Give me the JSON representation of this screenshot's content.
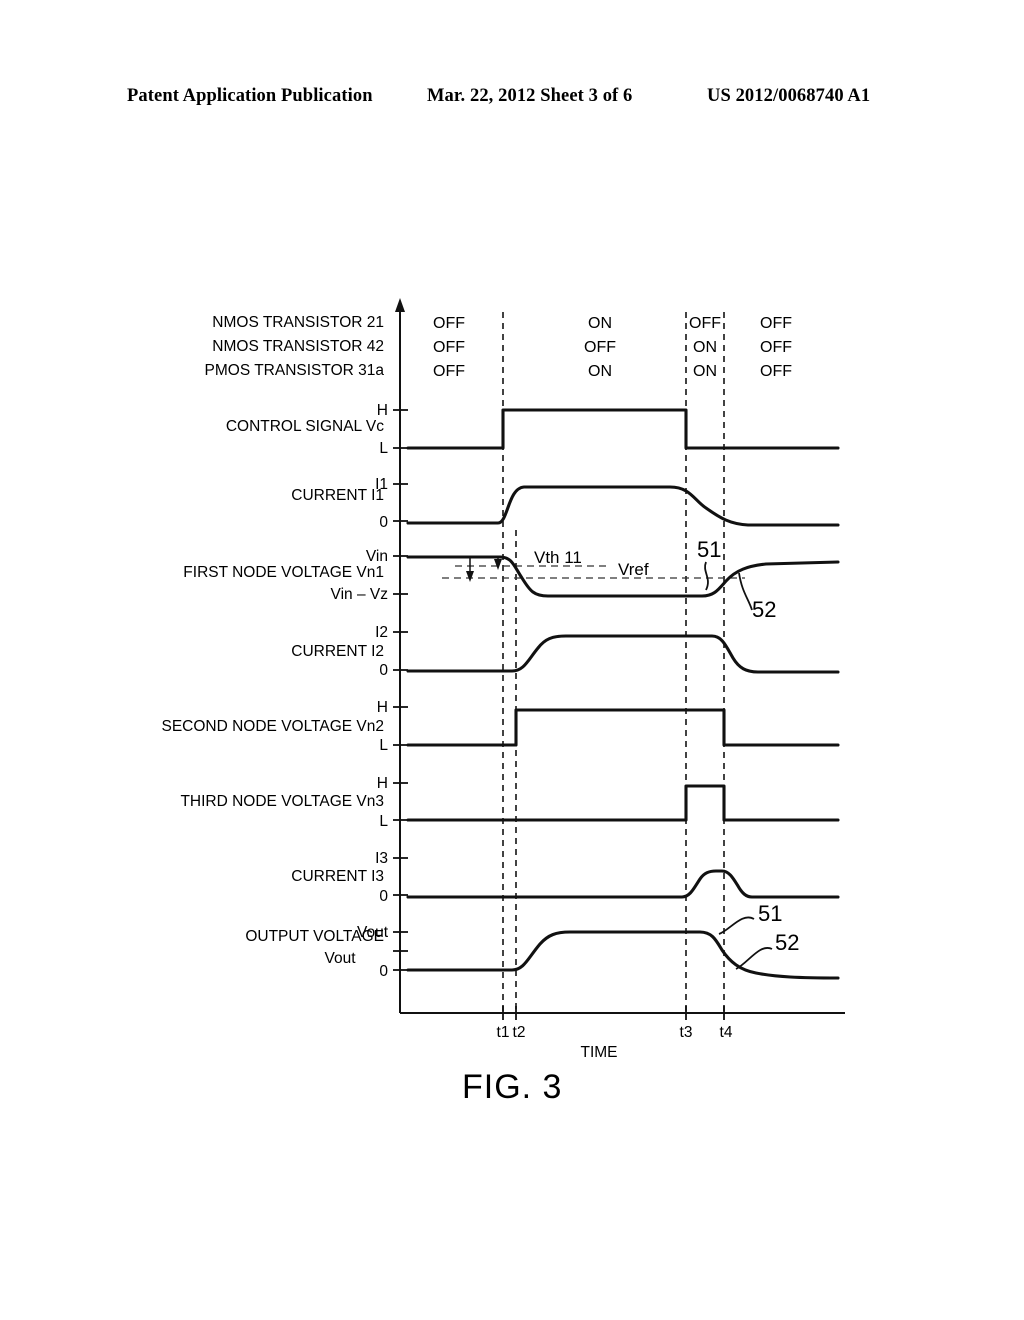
{
  "header": {
    "left": "Patent Application Publication",
    "middle": "Mar. 22, 2012  Sheet 3 of 6",
    "right": "US 2012/0068740 A1"
  },
  "figure": {
    "caption": "FIG. 3",
    "x_axis_label": "TIME",
    "time_marks": [
      "t1",
      "t2",
      "t3",
      "t4"
    ]
  },
  "state_table": {
    "rows": [
      {
        "label": "NMOS TRANSISTOR 21",
        "states": [
          "OFF",
          "ON",
          "OFF",
          "OFF"
        ]
      },
      {
        "label": "NMOS TRANSISTOR 42",
        "states": [
          "OFF",
          "OFF",
          "ON",
          "OFF"
        ]
      },
      {
        "label": "PMOS TRANSISTOR 31a",
        "states": [
          "OFF",
          "ON",
          "ON",
          "OFF"
        ]
      }
    ]
  },
  "waveforms": [
    {
      "name": "control-signal-vc",
      "label": "CONTROL SIGNAL Vc",
      "label2": "",
      "ticks": [
        "H",
        "L"
      ]
    },
    {
      "name": "current-i1",
      "label": "CURRENT I1",
      "label2": "",
      "ticks": [
        "I1",
        "0"
      ]
    },
    {
      "name": "first-node-voltage-vn1",
      "label": "FIRST NODE VOLTAGE Vn1",
      "label2": "",
      "ticks": [
        "Vin",
        "Vin – Vz"
      ]
    },
    {
      "name": "current-i2",
      "label": "CURRENT I2",
      "label2": "",
      "ticks": [
        "I2",
        "0"
      ]
    },
    {
      "name": "second-node-voltage-vn2",
      "label": "SECOND NODE VOLTAGE Vn2",
      "label2": "",
      "ticks": [
        "H",
        "L"
      ]
    },
    {
      "name": "third-node-voltage-vn3",
      "label": "THIRD NODE VOLTAGE Vn3",
      "label2": "",
      "ticks": [
        "H",
        "L"
      ]
    },
    {
      "name": "current-i3",
      "label": "CURRENT I3",
      "label2": "",
      "ticks": [
        "I3",
        "0"
      ]
    },
    {
      "name": "output-voltage-vout",
      "label": "OUTPUT VOLTAGE",
      "label2": "Vout",
      "ticks": [
        "Vout",
        "0"
      ]
    }
  ],
  "annotations": {
    "vth": "Vth 11",
    "vref": "Vref",
    "callout_vn1_51": "51",
    "callout_vn1_52": "52",
    "callout_vout_51": "51",
    "callout_vout_52": "52"
  },
  "chart_data": {
    "type": "line",
    "title": "FIG. 3",
    "xlabel": "TIME",
    "ylabel": "",
    "grid": false,
    "legend": "none",
    "x_ticks": [
      "t1",
      "t2",
      "t3",
      "t4"
    ],
    "x_tick_positions": [
      503,
      516,
      686,
      724
    ],
    "x_range": [
      400,
      840
    ],
    "series": [
      {
        "name": "CONTROL SIGNAL Vc",
        "levels": [
          "L",
          "H"
        ],
        "points": [
          [
            400,
            "L"
          ],
          [
            503,
            "L"
          ],
          [
            503,
            "H"
          ],
          [
            686,
            "H"
          ],
          [
            686,
            "L"
          ],
          [
            840,
            "L"
          ]
        ]
      },
      {
        "name": "CURRENT I1",
        "levels": [
          "0",
          "I1"
        ],
        "points": [
          [
            400,
            "0"
          ],
          [
            503,
            "0"
          ],
          [
            520,
            "I1"
          ],
          [
            686,
            "I1"
          ],
          [
            710,
            "mid"
          ],
          [
            760,
            "0"
          ],
          [
            840,
            "0"
          ]
        ]
      },
      {
        "name": "FIRST NODE VOLTAGE Vn1",
        "levels": [
          "Vin",
          "Vin - Vz"
        ],
        "points": [
          [
            400,
            "Vin"
          ],
          [
            503,
            "Vin"
          ],
          [
            516,
            "Vin"
          ],
          [
            540,
            "Vin-Vz"
          ],
          [
            686,
            "Vin-Vz"
          ],
          [
            724,
            "Vin-Vz"
          ],
          [
            760,
            "Vref"
          ],
          [
            840,
            "Vin"
          ]
        ]
      },
      {
        "name": "CURRENT I2",
        "levels": [
          "0",
          "I2"
        ],
        "points": [
          [
            400,
            "0"
          ],
          [
            516,
            "0"
          ],
          [
            545,
            "I2"
          ],
          [
            724,
            "I2"
          ],
          [
            745,
            "0"
          ],
          [
            840,
            "0"
          ]
        ]
      },
      {
        "name": "SECOND NODE VOLTAGE Vn2",
        "levels": [
          "L",
          "H"
        ],
        "points": [
          [
            400,
            "L"
          ],
          [
            516,
            "L"
          ],
          [
            516,
            "H"
          ],
          [
            724,
            "H"
          ],
          [
            724,
            "L"
          ],
          [
            840,
            "L"
          ]
        ]
      },
      {
        "name": "THIRD NODE VOLTAGE Vn3",
        "levels": [
          "L",
          "H"
        ],
        "points": [
          [
            400,
            "L"
          ],
          [
            686,
            "L"
          ],
          [
            686,
            "H"
          ],
          [
            724,
            "H"
          ],
          [
            724,
            "L"
          ],
          [
            840,
            "L"
          ]
        ]
      },
      {
        "name": "CURRENT I3",
        "levels": [
          "0",
          "I3"
        ],
        "points": [
          [
            400,
            "0"
          ],
          [
            686,
            "0"
          ],
          [
            700,
            "I3"
          ],
          [
            724,
            "I3"
          ],
          [
            740,
            "0"
          ],
          [
            840,
            "0"
          ]
        ]
      },
      {
        "name": "OUTPUT VOLTAGE Vout",
        "levels": [
          "0",
          "Vout"
        ],
        "points": [
          [
            400,
            "0"
          ],
          [
            516,
            "0"
          ],
          [
            548,
            "Vout"
          ],
          [
            686,
            "Vout"
          ],
          [
            724,
            "mid"
          ],
          [
            780,
            "0"
          ],
          [
            840,
            "0"
          ]
        ]
      }
    ]
  }
}
